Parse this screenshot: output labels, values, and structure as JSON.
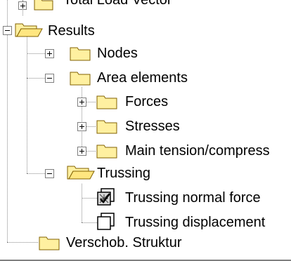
{
  "tree": {
    "partial_top": {
      "label": "Total Load Vector"
    },
    "results": {
      "label": "Results",
      "children": {
        "nodes": {
          "label": "Nodes"
        },
        "area_elements": {
          "label": "Area elements",
          "children": {
            "forces": {
              "label": "Forces"
            },
            "stresses": {
              "label": "Stresses"
            },
            "main_tension": {
              "label": "Main tension/compress"
            }
          }
        },
        "trussing": {
          "label": "Trussing",
          "children": {
            "normal_force": {
              "label": "Trussing normal force",
              "checked": true
            },
            "displacement": {
              "label": "Trussing displacement",
              "checked": false
            }
          }
        }
      }
    },
    "verschob": {
      "label": "Verschob. Struktur"
    }
  },
  "colors": {
    "folder_fill": "#fff0a0",
    "folder_edge": "#806000",
    "dots": "#8a8a8a"
  }
}
